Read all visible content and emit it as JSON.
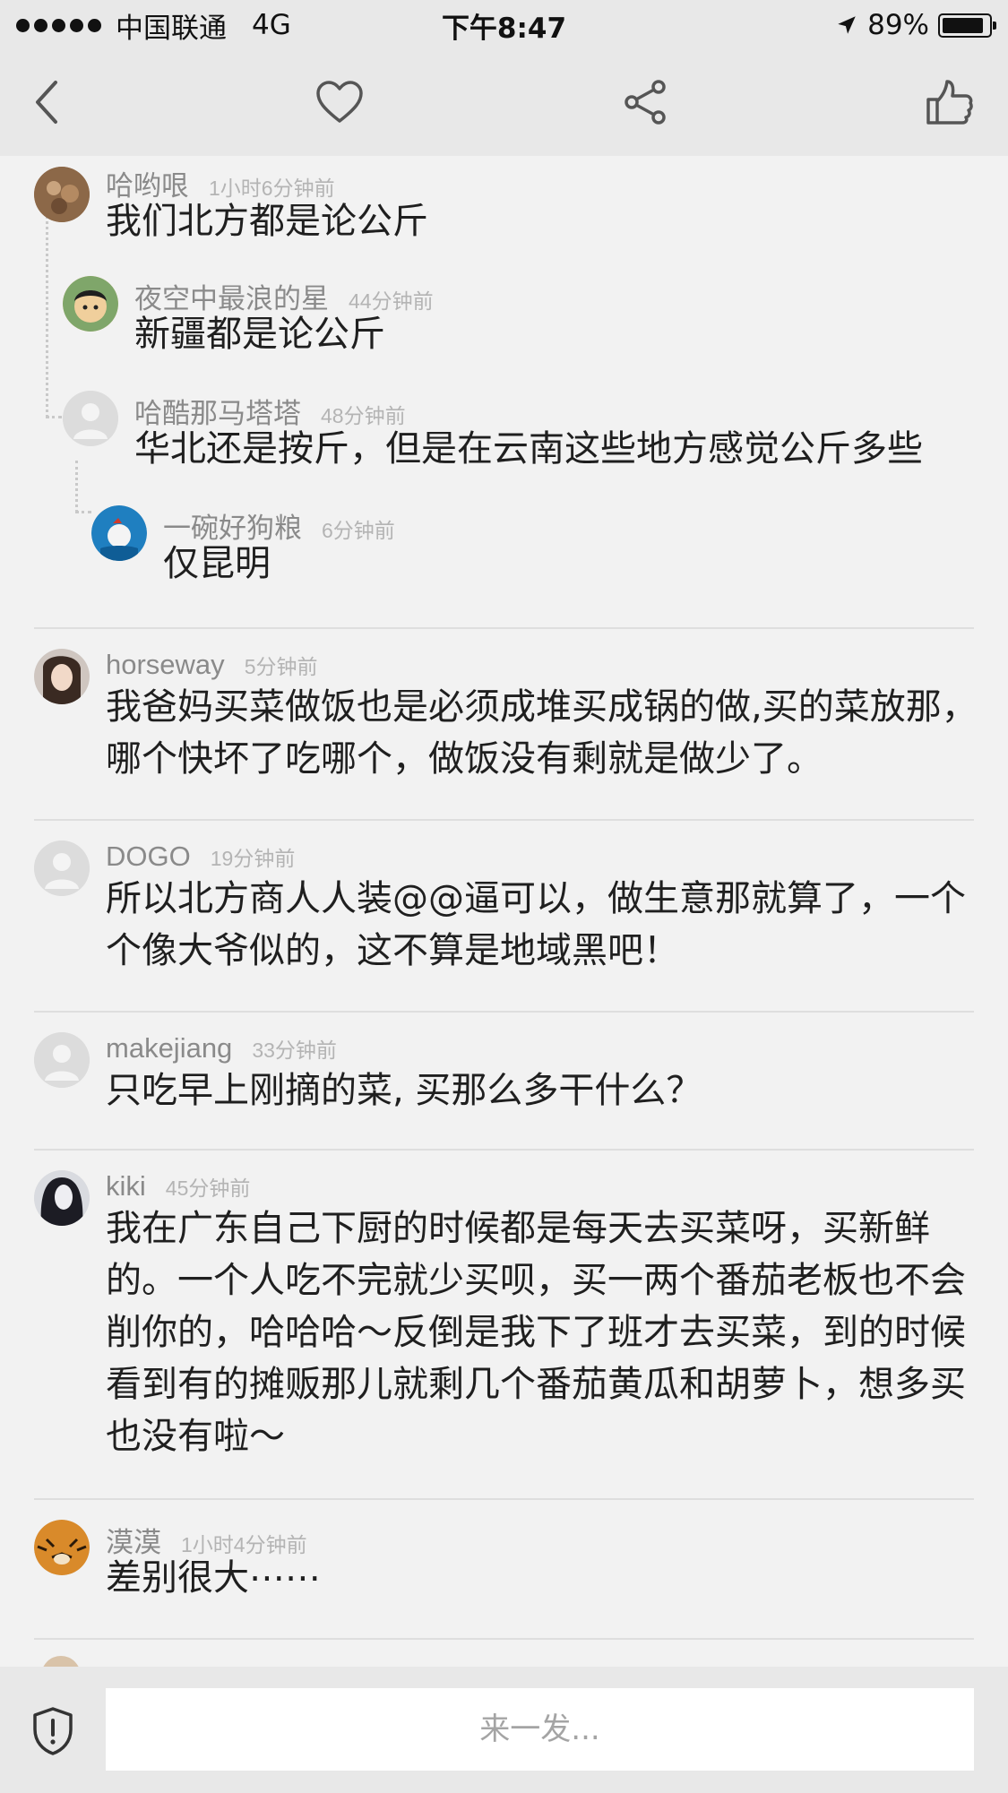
{
  "status_bar": {
    "carrier": "中国联通",
    "network": "4G",
    "time": "下午8:47",
    "battery_pct": "89%",
    "battery_level": 0.89
  },
  "nav": {
    "icons": [
      "back-icon",
      "heart-icon",
      "share-icon",
      "thumbs-up-icon"
    ]
  },
  "comments": [
    {
      "user": "哈哟哏",
      "time": "1小时6分钟前",
      "text": "我们北方都是论公斤"
    },
    {
      "user": "夜空中最浪的星",
      "time": "44分钟前",
      "text": "新疆都是论公斤"
    },
    {
      "user": "哈酷那马塔塔",
      "time": "48分钟前",
      "text": "华北还是按斤，但是在云南这些地方感觉公斤多些"
    },
    {
      "user": "一碗好狗粮",
      "time": "6分钟前",
      "text": "仅昆明"
    },
    {
      "user": "horseway",
      "time": "5分钟前",
      "text": "我爸妈买菜做饭也是必须成堆买成锅的做,买的菜放那，哪个快坏了吃哪个，做饭没有剩就是做少了。"
    },
    {
      "user": "DOGO",
      "time": "19分钟前",
      "text": "所以北方商人人装@@逼可以，做生意那就算了，一个个像大爷似的，这不算是地域黑吧！"
    },
    {
      "user": "makejiang",
      "time": "33分钟前",
      "text": "只吃早上刚摘的菜, 买那么多干什么？"
    },
    {
      "user": "kiki",
      "time": "45分钟前",
      "text": "我在广东自己下厨的时候都是每天去买菜呀，买新鲜的。一个人吃不完就少买呗，买一两个番茄老板也不会削你的，哈哈哈～反倒是我下了班才去买菜，到的时候看到有的摊贩那儿就剩几个番茄黄瓜和胡萝卜，想多买也没有啦～"
    },
    {
      "user": "漠漠",
      "time": "1小时4分钟前",
      "text": "差别很大⋯⋯"
    }
  ],
  "composer": {
    "placeholder": "来一发..."
  },
  "colors": {
    "bar_bg": "#e8e8e8",
    "page_bg": "#f2f2f2",
    "username": "#8a8a8a",
    "timestamp": "#b4b4b4"
  }
}
